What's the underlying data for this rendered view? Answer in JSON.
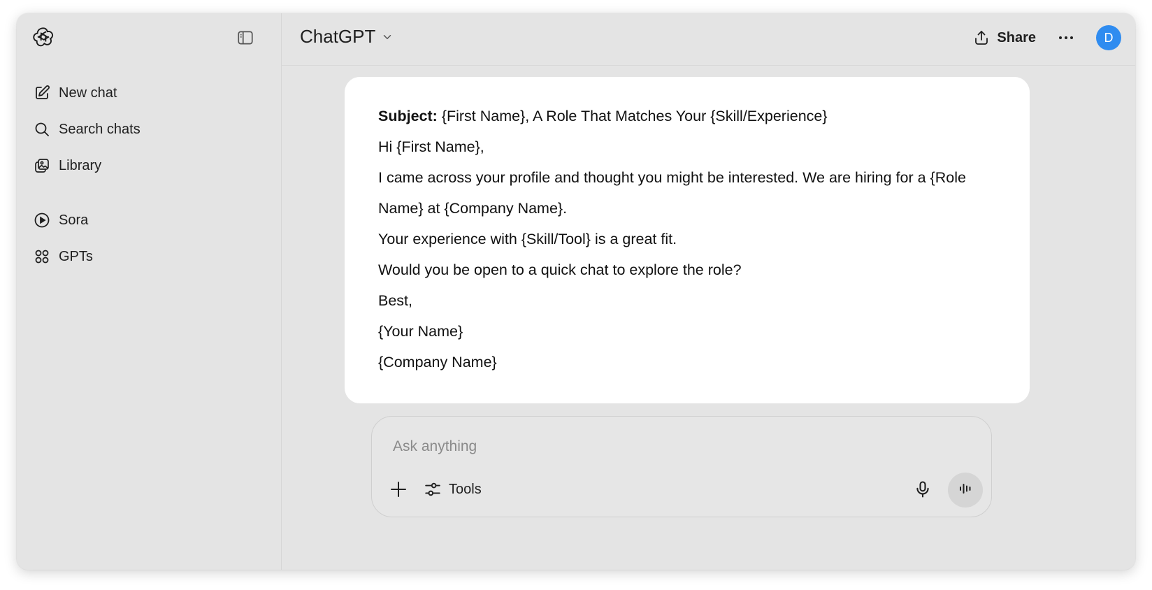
{
  "sidebar": {
    "items": [
      {
        "label": "New chat",
        "icon": "compose-icon"
      },
      {
        "label": "Search chats",
        "icon": "search-icon"
      },
      {
        "label": "Library",
        "icon": "library-icon"
      },
      {
        "label": "Sora",
        "icon": "play-circle-icon"
      },
      {
        "label": "GPTs",
        "icon": "grid-icon"
      }
    ]
  },
  "header": {
    "model": "ChatGPT",
    "share_label": "Share",
    "avatar_initial": "D",
    "avatar_color": "#2f8cf0"
  },
  "message": {
    "subject_label": "Subject:",
    "subject_text": " {First Name}, A Role That Matches Your {Skill/Experience}",
    "lines": [
      "Hi {First Name},",
      "I came across your profile and thought you might be interested. We are hiring for a {Role Name} at {Company Name}.",
      "Your experience with {Skill/Tool} is a great fit.",
      "Would you be open to a quick chat to explore the role?",
      "Best,",
      "{Your Name}",
      "{Company Name}"
    ]
  },
  "composer": {
    "placeholder": "Ask anything",
    "value": "",
    "tools_label": "Tools"
  }
}
